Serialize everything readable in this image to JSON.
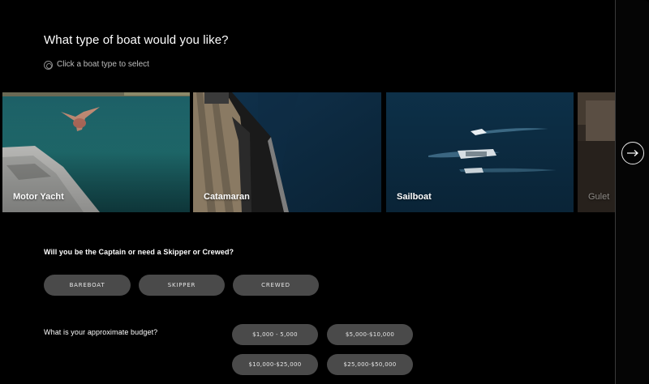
{
  "heading": "What type of boat would you like?",
  "hint": "Click a boat type to select",
  "boat_types": [
    {
      "label": "Motor Yacht"
    },
    {
      "label": "Catamaran"
    },
    {
      "label": "Sailboat"
    },
    {
      "label": "Gulet"
    }
  ],
  "carousel": {
    "next_icon": "arrow-right-icon"
  },
  "crew_question": "Will you be the Captain or need a Skipper or Crewed?",
  "crew_options": [
    "BAREBOAT",
    "SKIPPER",
    "CREWED"
  ],
  "budget_question": "What is your approximate budget?",
  "budget_options": [
    "$1,000 - 5,000",
    "$5,000-$10,000",
    "$10,000-$25,000",
    "$25,000-$50,000"
  ],
  "colors": {
    "background": "#000000",
    "pill": "#4a4a4a",
    "water_teal": "#1f6d72",
    "water_deep": "#0b2a44"
  }
}
